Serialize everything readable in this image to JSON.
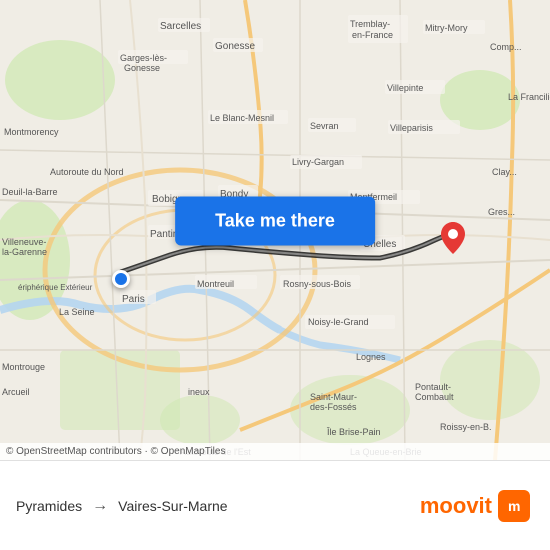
{
  "map": {
    "attribution": "© OpenStreetMap contributors · © OpenMapTiles",
    "button_label": "Take me there",
    "origin_name": "Pyramides",
    "destination_name": "Vaires-Sur-Marne"
  },
  "bottom": {
    "from_label": "Pyramides",
    "arrow": "→",
    "to_label": "Vaires-Sur-Marne",
    "app_name": "moovit",
    "app_icon_letter": "m"
  },
  "colors": {
    "button_bg": "#1a73e8",
    "origin_marker": "#1a73e8",
    "destination_marker": "#e53935",
    "route_color": "#1a1a1a",
    "moovit_orange": "#ff6600"
  }
}
